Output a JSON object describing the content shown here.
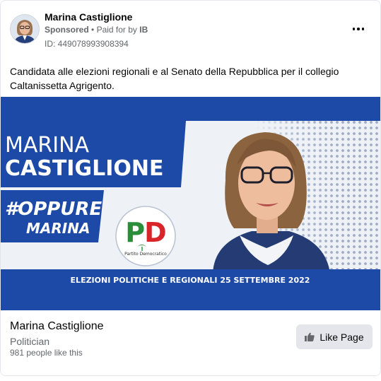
{
  "post": {
    "page_name": "Marina Castiglione",
    "sponsored": "Sponsored",
    "separator": "•",
    "paid_prefix": "Paid for by",
    "paid_by": "IB",
    "ad_id": "ID: 449078993908394",
    "more_icon": "more-horizontal-icon",
    "text": "Candidata alle elezioni regionali e al Senato della Repubblica per il collegio Caltanissetta Agrigento."
  },
  "creative": {
    "first_name": "MARINA",
    "last_name": "CASTIGLIONE",
    "hashtag_line1": "#OPPURE",
    "hashtag_line2": "MARINA",
    "logo_letters": "PD",
    "logo_caption": "Partito Democratico",
    "banner_text": "ELEZIONI POLITICHE E REGIONALI 25 SETTEMBRE 2022",
    "colors": {
      "blue": "#1c4aa6",
      "light": "#eef1f6",
      "green": "#2a8d3a",
      "red": "#d9242a"
    }
  },
  "footer": {
    "page_name": "Marina Castiglione",
    "category": "Politician",
    "likes": "981 people like this",
    "like_button": "Like Page",
    "like_icon": "thumbs-up-icon"
  }
}
